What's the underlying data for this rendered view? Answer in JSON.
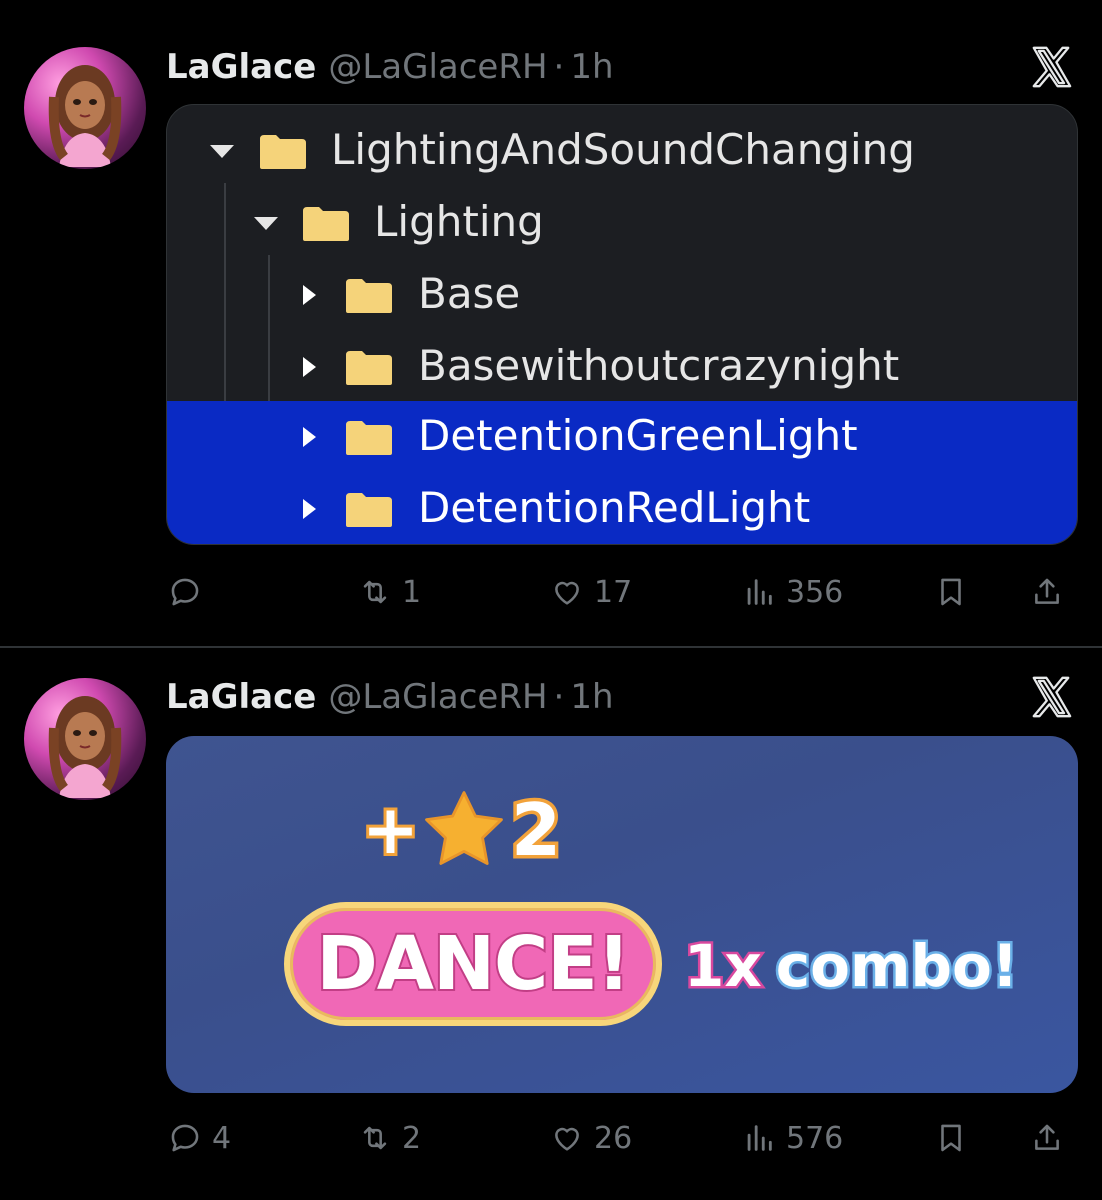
{
  "tweets": [
    {
      "author": {
        "name": "LaGlace",
        "handle": "@LaGlaceRH",
        "time": "1h"
      },
      "media": {
        "explorer": {
          "items": [
            {
              "label": "LightingAndSoundChanging",
              "expanded": true,
              "selected": false
            },
            {
              "label": "Lighting",
              "expanded": true,
              "selected": false
            },
            {
              "label": "Base",
              "expanded": false,
              "selected": false
            },
            {
              "label": "Basewithoutcrazynight",
              "expanded": false,
              "selected": false
            },
            {
              "label": "DetentionGreenLight",
              "expanded": false,
              "selected": true
            },
            {
              "label": "DetentionRedLight",
              "expanded": false,
              "selected": true
            }
          ]
        }
      },
      "actions": {
        "replies": "",
        "reposts": "1",
        "likes": "17",
        "views": "356"
      }
    },
    {
      "author": {
        "name": "LaGlace",
        "handle": "@LaGlaceRH",
        "time": "1h"
      },
      "media": {
        "game": {
          "plus": "+",
          "star_count": "2",
          "dance": "DANCE!",
          "combo_count": "1x",
          "combo_word": "combo!"
        }
      },
      "actions": {
        "replies": "4",
        "reposts": "2",
        "likes": "26",
        "views": "576"
      }
    }
  ],
  "colors": {
    "background": "#000000",
    "selection": "#0a2ac4",
    "folder": "#f5d37a",
    "muted": "#71767b",
    "pill": "#f068b6"
  },
  "icons": [
    "x-logo-icon",
    "folder-icon",
    "reply-icon",
    "repost-icon",
    "like-icon",
    "views-icon",
    "bookmark-icon",
    "share-icon"
  ]
}
